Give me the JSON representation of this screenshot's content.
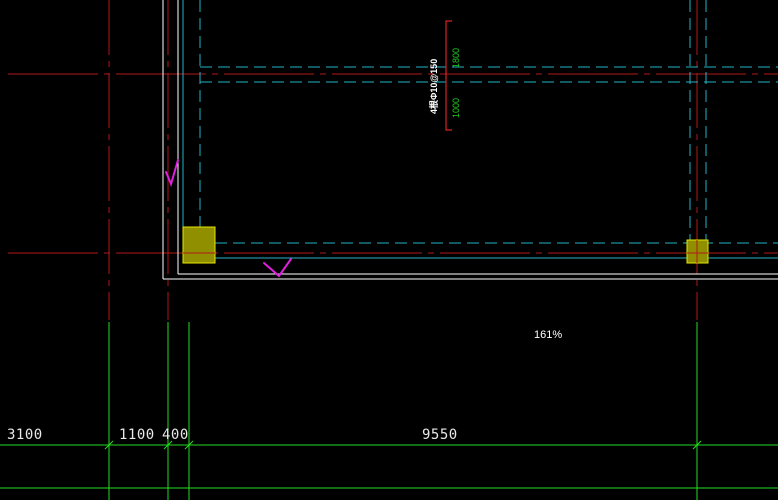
{
  "zoom_label": "161%",
  "dimensions": {
    "d1": "3100",
    "d2": "1100",
    "d3": "400",
    "d4": "9550"
  },
  "rebar_note": {
    "main": "4根Φ10@150",
    "top_value": "1800",
    "bottom_value": "1000"
  },
  "colors": {
    "background": "#000000",
    "axis_red": "#b01818",
    "beam_cyan": "#22b4c8",
    "wall_white": "#ffffff",
    "dim_green": "#22dd22",
    "column_fill": "#8f8f00",
    "column_stroke": "#e6e600",
    "mark_magenta": "#e020e0"
  }
}
